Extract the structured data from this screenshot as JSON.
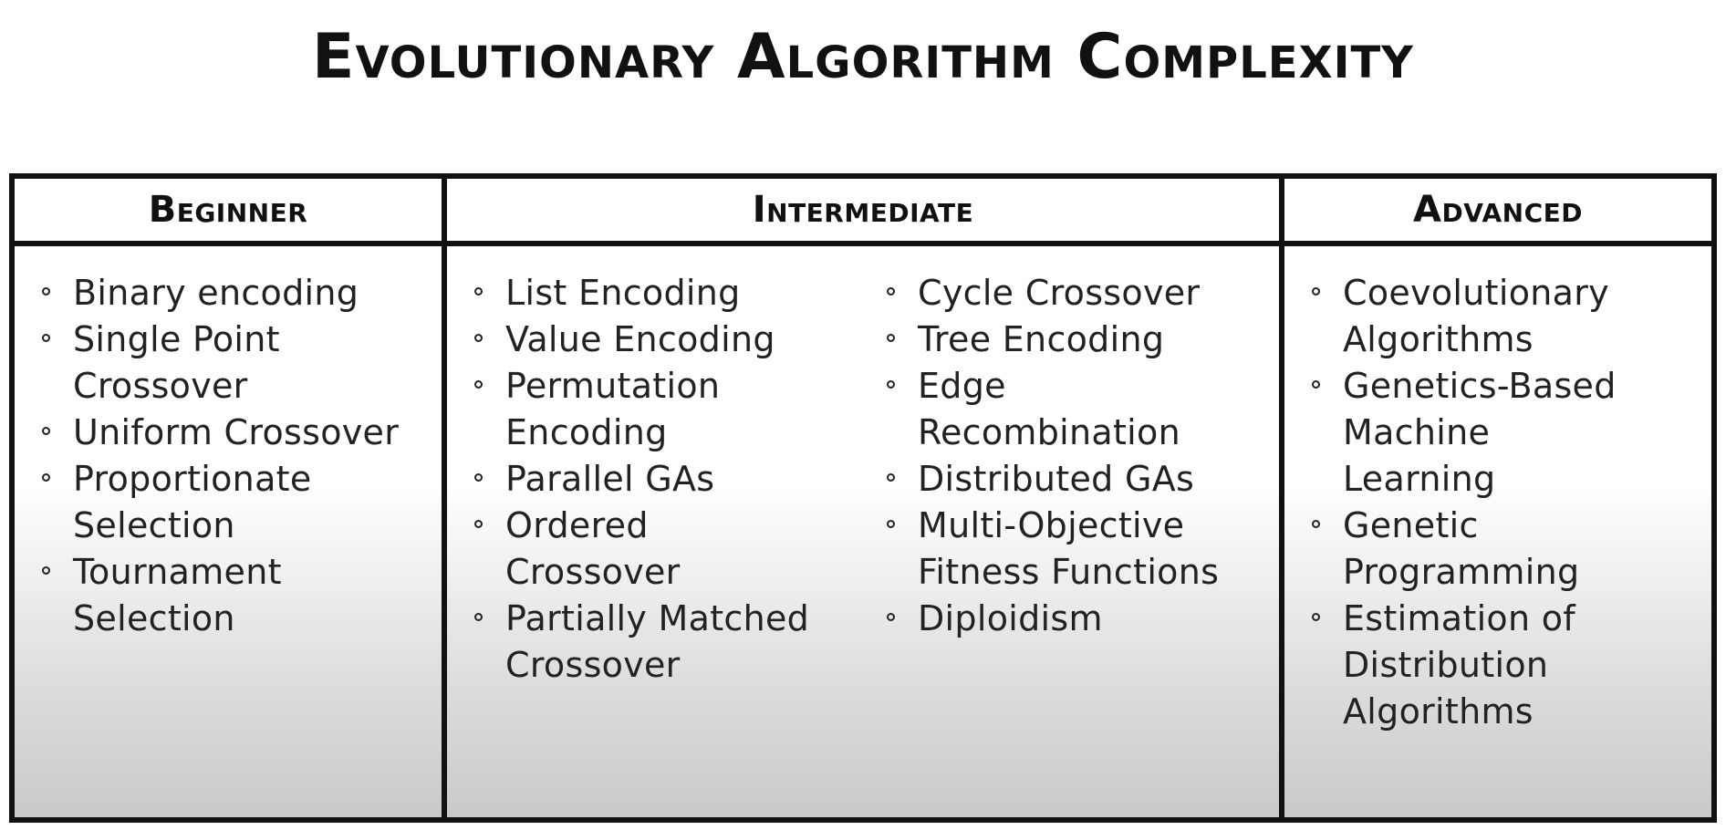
{
  "title": "Evolutionary Algorithm Complexity",
  "columns": {
    "beginner": {
      "heading": "Beginner",
      "items": [
        "Binary encoding",
        "Single Point Crossover",
        "Uniform Crossover",
        "Proportionate Selection",
        "Tournament Selection"
      ]
    },
    "intermediate": {
      "heading": "Intermediate",
      "left_items": [
        "List Encoding",
        "Value Encoding",
        "Permutation Encoding",
        "Parallel GAs",
        "Ordered Crossover",
        "Partially Matched Crossover"
      ],
      "right_items": [
        "Cycle Crossover",
        "Tree Encoding",
        "Edge Recombination",
        "Distributed GAs",
        "Multi-Objective Fitness Functions",
        "Diploidism"
      ]
    },
    "advanced": {
      "heading": "Advanced",
      "items": [
        "Coevolutionary Algorithms",
        "Genetics-Based Machine Learning",
        "Genetic Programming",
        "Estimation of Distribution Algorithms"
      ]
    }
  }
}
